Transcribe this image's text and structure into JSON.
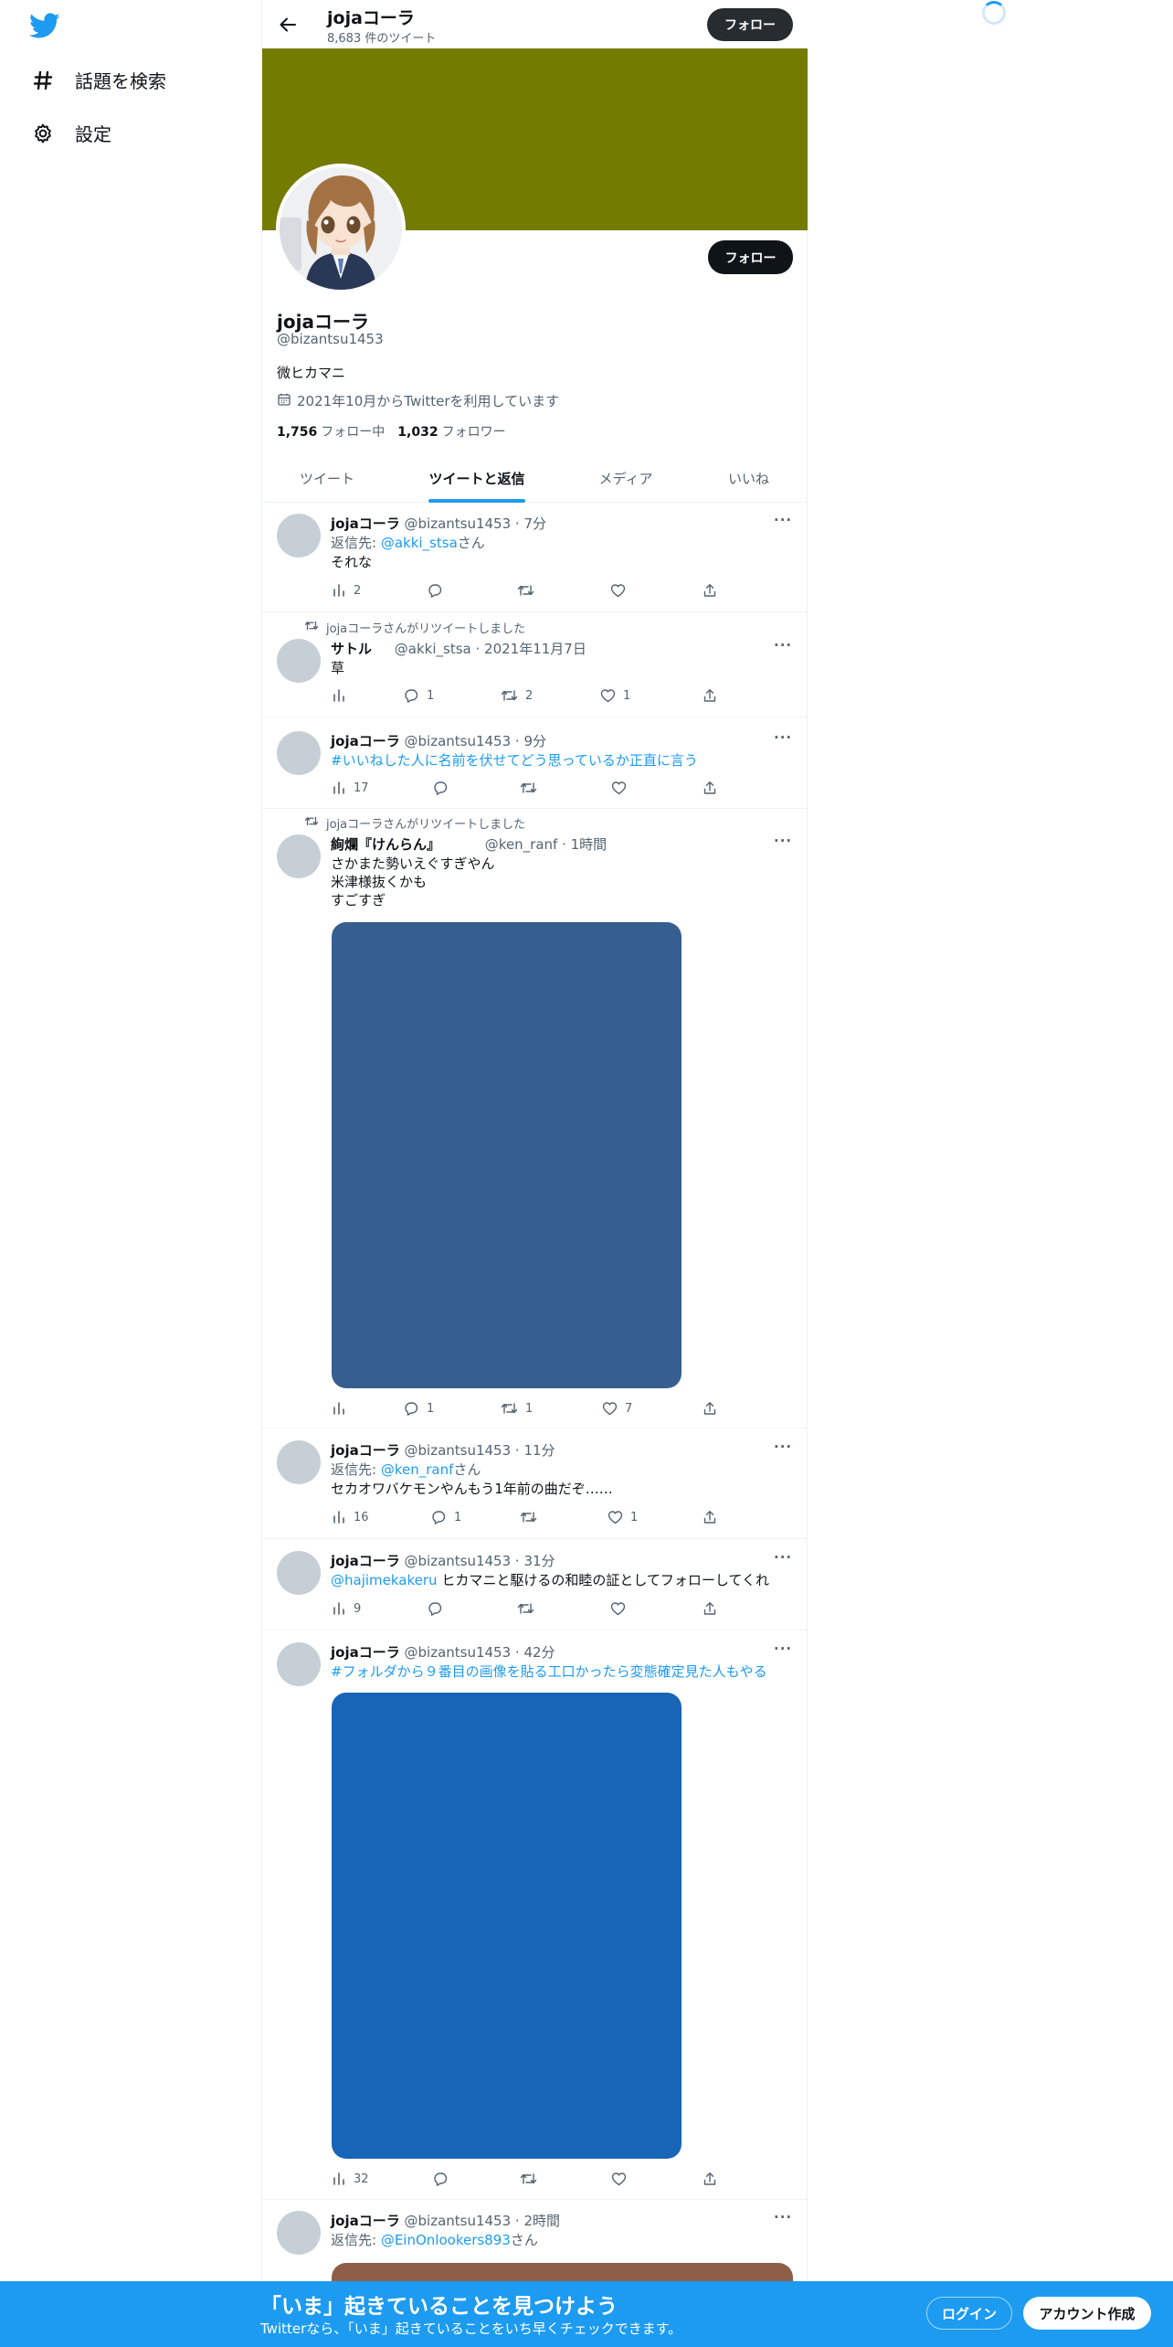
{
  "nav": {
    "logo": "twitter-bird-icon",
    "items": [
      {
        "label": "話題を検索",
        "icon": "hashtag-icon"
      },
      {
        "label": "設定",
        "icon": "gear-icon"
      }
    ]
  },
  "profile": {
    "name": "jojaコーラ",
    "tweet_count": "8,683 件のツイート",
    "follow_label": "フォロー",
    "handle": "@bizantsu1453",
    "bio": "微ヒカマニ",
    "joined": "2021年10月からTwitterを利用しています",
    "following_count": "1,756",
    "following_label": "フォロー中",
    "followers_count": "1,032",
    "followers_label": "フォロワー",
    "banner_color": "#737b00"
  },
  "tabs": [
    "ツイート",
    "ツイートと返信",
    "メディア",
    "いいね"
  ],
  "tweets": [
    {
      "name": "jojaコーラ",
      "meta": "@bizantsu1453 · 7分",
      "reply_prefix": "返信先: ",
      "reply_to": "@akki_stsa",
      "reply_suffix": "さん",
      "text": "それな",
      "views": "2",
      "replies": "",
      "retweets": "",
      "likes": ""
    },
    {
      "retweeted_by": "jojaコーラさんがリツイートしました",
      "name": "サトル",
      "meta": "@akki_stsa · 2021年11月7日",
      "text": "草",
      "views": "",
      "replies": "1",
      "retweets": "2",
      "likes": "1"
    },
    {
      "name": "jojaコーラ",
      "meta": "@bizantsu1453 · 9分",
      "hashtag_text": "#いいねした人に名前を伏せてどう思っているか正直に言う",
      "views": "17",
      "replies": "",
      "retweets": "",
      "likes": ""
    },
    {
      "retweeted_by": "jojaコーラさんがリツイートしました",
      "name": "絢爛『けんらん』",
      "meta": "@ken_ranf · 1時間",
      "lines": [
        "さかまた勢いえぐすぎやん",
        "米津様抜くかも",
        "すごすぎ"
      ],
      "media_color": "#365f8f",
      "views": "",
      "replies": "1",
      "retweets": "1",
      "likes": "7"
    },
    {
      "name": "jojaコーラ",
      "meta": "@bizantsu1453 · 11分",
      "reply_prefix": "返信先: ",
      "reply_to": "@ken_ranf",
      "reply_suffix": "さん",
      "text": "セカオワバケモンやんもう1年前の曲だぞ……",
      "views": "16",
      "replies": "1",
      "retweets": "",
      "likes": "1"
    },
    {
      "name": "jojaコーラ",
      "meta": "@bizantsu1453 · 31分",
      "mention": "@hajimekakeru",
      "text": " ヒカマニと駆けるの和睦の証としてフォローしてくれ",
      "views": "9",
      "replies": "",
      "retweets": "",
      "likes": ""
    },
    {
      "name": "jojaコーラ",
      "meta": "@bizantsu1453 · 42分",
      "hashtag_text": "#フォルダから９番目の画像を貼る工口かったら変態確定見た人もやる",
      "media_color": "#1865b8",
      "views": "32",
      "replies": "",
      "retweets": "",
      "likes": ""
    },
    {
      "name": "jojaコーラ",
      "meta": "@bizantsu1453 · 2時間",
      "reply_prefix": "返信先: ",
      "reply_to": "@EinOnlookers893",
      "reply_suffix": "さん",
      "media_color": "#8d5e47"
    }
  ],
  "bottom_bar": {
    "title": "「いま」起きていることを見つけよう",
    "subtitle": "Twitterなら、「いま」起きていることをいち早くチェックできます。",
    "login": "ログイン",
    "signup": "アカウント作成"
  }
}
